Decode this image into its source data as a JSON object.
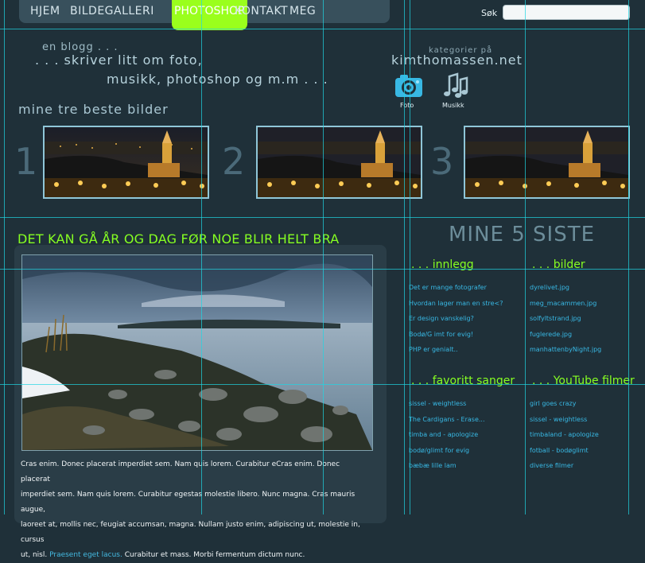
{
  "nav": {
    "items": [
      "HJEM",
      "BILDEGALLERI",
      "PHOTOSHOP",
      "KONTAKT",
      "MEG"
    ],
    "active": "PHOTOSHOP"
  },
  "search": {
    "label": "Søk",
    "value": ""
  },
  "intro": {
    "line1": "en blogg . . .",
    "line2": ". . . skriver litt om foto,",
    "line3": "musikk, photoshop og m.m . . ."
  },
  "categories": {
    "prefix": "kategorier på",
    "site": "kimthomassen.net",
    "items": [
      {
        "label": "Foto",
        "icon": "camera-icon"
      },
      {
        "label": "Musikk",
        "icon": "music-notes-icon"
      }
    ]
  },
  "best": {
    "title": "mine tre beste bilder",
    "numbers": [
      "1",
      "2",
      "3"
    ]
  },
  "article": {
    "title": "DET KAN GÅ ÅR OG DAG FØR NOE BLIR HELT BRA",
    "text_line1": "Cras enim. Donec placerat imperdiet sem. Nam quis lorem. Curabitur eCras enim. Donec placerat",
    "text_line2": "imperdiet sem. Nam quis lorem. Curabitur egestas molestie libero. Nunc magna. Cras mauris augue,",
    "text_line3": "laoreet at, mollis nec, feugiat accumsan, magna. Nullam justo enim, adipiscing ut, molestie in, cursus",
    "text_line4_start": "ut, nisl.",
    "text_link": "Praesent eget lacus.",
    "text_line4_end": "Curabitur et mass. Morbi fermentum dictum nunc."
  },
  "sidebar": {
    "title": "MINE 5 SISTE",
    "innlegg_title": ". . . innlegg",
    "innlegg": [
      "Det er mange fotografer",
      "Hvordan lager man en stre<?",
      "Er design vanskelig?",
      "Bodø/G imt for evig!",
      "PHP er genialt.."
    ],
    "bilder_title": ". . . bilder",
    "bilder": [
      "dyrelivet.jpg",
      "meg_macammen.jpg",
      "solfyltstrand.jpg",
      "fuglerede.jpg",
      "manhattenbyNight.jpg"
    ],
    "sanger_title": ". . . favoritt sanger",
    "sanger": [
      "sissel - weightless",
      "The Cardigans - Erase...",
      "timba and - apologize",
      "bodø/glimt for evig",
      "bæbæ lille lam"
    ],
    "youtube_title": ". . . YouTube filmer",
    "youtube": [
      "girl goes crazy",
      "sissel - weightless",
      "timbaland - apologize",
      "fotball - bodøglimt",
      "diverse filmer"
    ]
  },
  "colors": {
    "background": "#1f3039",
    "accent": "#86ff22",
    "link": "#38b8e4"
  }
}
